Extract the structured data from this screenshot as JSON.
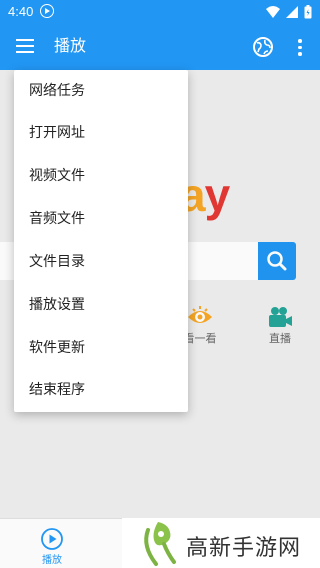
{
  "status_bar": {
    "time": "4:40"
  },
  "app_bar": {
    "title": "播放"
  },
  "main": {
    "brand_logo_partial": [
      "a",
      "y"
    ],
    "search": {
      "value": "",
      "placeholder": ""
    },
    "shortcuts": [
      {
        "label": "看一看",
        "icon": "eye-icon"
      },
      {
        "label": "直播",
        "icon": "camera-icon"
      }
    ]
  },
  "menu": {
    "items": [
      "网络任务",
      "打开网址",
      "视频文件",
      "音频文件",
      "文件目录",
      "播放设置",
      "软件更新",
      "结束程序"
    ]
  },
  "bottom_nav": {
    "play_label": "播放"
  },
  "watermark": {
    "text": "高新手游网"
  },
  "colors": {
    "primary": "#2196f3",
    "logo_yellow": "#f9a825",
    "logo_red": "#e53935",
    "watermark_green": "#8bc34a"
  }
}
